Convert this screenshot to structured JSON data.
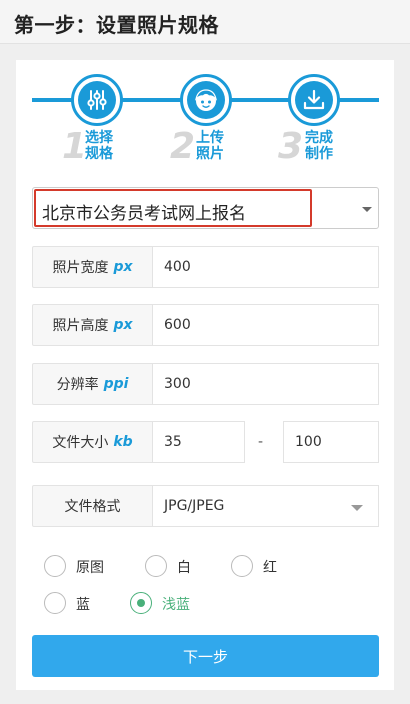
{
  "header": {
    "title": "第一步：设置照片规格"
  },
  "steps": [
    {
      "number": "1",
      "label": "选择规格",
      "icon": "sliders-icon"
    },
    {
      "number": "2",
      "label": "上传照片",
      "icon": "face-icon"
    },
    {
      "number": "3",
      "label": "完成制作",
      "icon": "download-icon"
    }
  ],
  "region": {
    "selected": "北京市公务员考试网上报名"
  },
  "fields": {
    "width": {
      "label": "照片宽度",
      "unit": "px",
      "value": "400"
    },
    "height": {
      "label": "照片高度",
      "unit": "px",
      "value": "600"
    },
    "resolution": {
      "label": "分辨率",
      "unit": "ppi",
      "value": "300"
    },
    "filesize": {
      "label": "文件大小",
      "unit": "kb",
      "min": "35",
      "separator": "-",
      "max": "100"
    },
    "format": {
      "label": "文件格式",
      "value": "JPG/JPEG"
    }
  },
  "background_options": [
    {
      "label": "原图",
      "checked": false
    },
    {
      "label": "白",
      "checked": false
    },
    {
      "label": "红",
      "checked": false
    },
    {
      "label": "蓝",
      "checked": false
    },
    {
      "label": "浅蓝",
      "checked": true
    }
  ],
  "buttons": {
    "next_label": "下一步"
  },
  "colors": {
    "accent": "#1a9ad8",
    "button": "#31a8ec",
    "highlight": "#d43a2b",
    "checked": "#49b07a"
  }
}
